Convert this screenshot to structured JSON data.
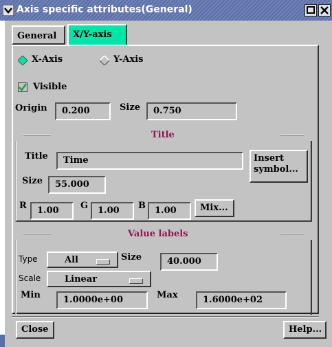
{
  "window": {
    "title": "Axis specific attributes(General)"
  },
  "tabs": [
    {
      "label": "General"
    },
    {
      "label": "X/Y-axis"
    }
  ],
  "axis_choice": {
    "x_label": "X-Axis",
    "y_label": "Y-Axis",
    "selected": "X-Axis"
  },
  "visible": {
    "label": "Visible",
    "checked": true
  },
  "origin": {
    "label": "Origin",
    "value": "0.200"
  },
  "size": {
    "label": "Size",
    "value": "0.750"
  },
  "title_group": {
    "heading": "Title",
    "title_label": "Title",
    "title_value": "Time",
    "insert_button_line1": "Insert",
    "insert_button_line2": "symbol...",
    "size_label": "Size",
    "size_value": "55.000",
    "r_label": "R",
    "r_value": "1.00",
    "g_label": "G",
    "g_value": "1.00",
    "b_label": "B",
    "b_value": "1.00",
    "mix_button": "Mix..."
  },
  "value_labels": {
    "heading": "Value labels",
    "type_label": "Type",
    "type_value": "All",
    "size_label": "Size",
    "size_value": "40.000",
    "scale_label": "Scale",
    "scale_value": "Linear",
    "min_label": "Min",
    "min_value": "1.0000e+00",
    "max_label": "Max",
    "max_value": "1.6000e+02"
  },
  "footer": {
    "close_button": "Close",
    "help_button": "Help..."
  },
  "colors": {
    "titlebar": "#5c6ea6",
    "active_tab": "#00e5a8",
    "group_heading": "#8b1a55",
    "window_bg": "#c3c3c3",
    "check": "#1aa34a"
  }
}
